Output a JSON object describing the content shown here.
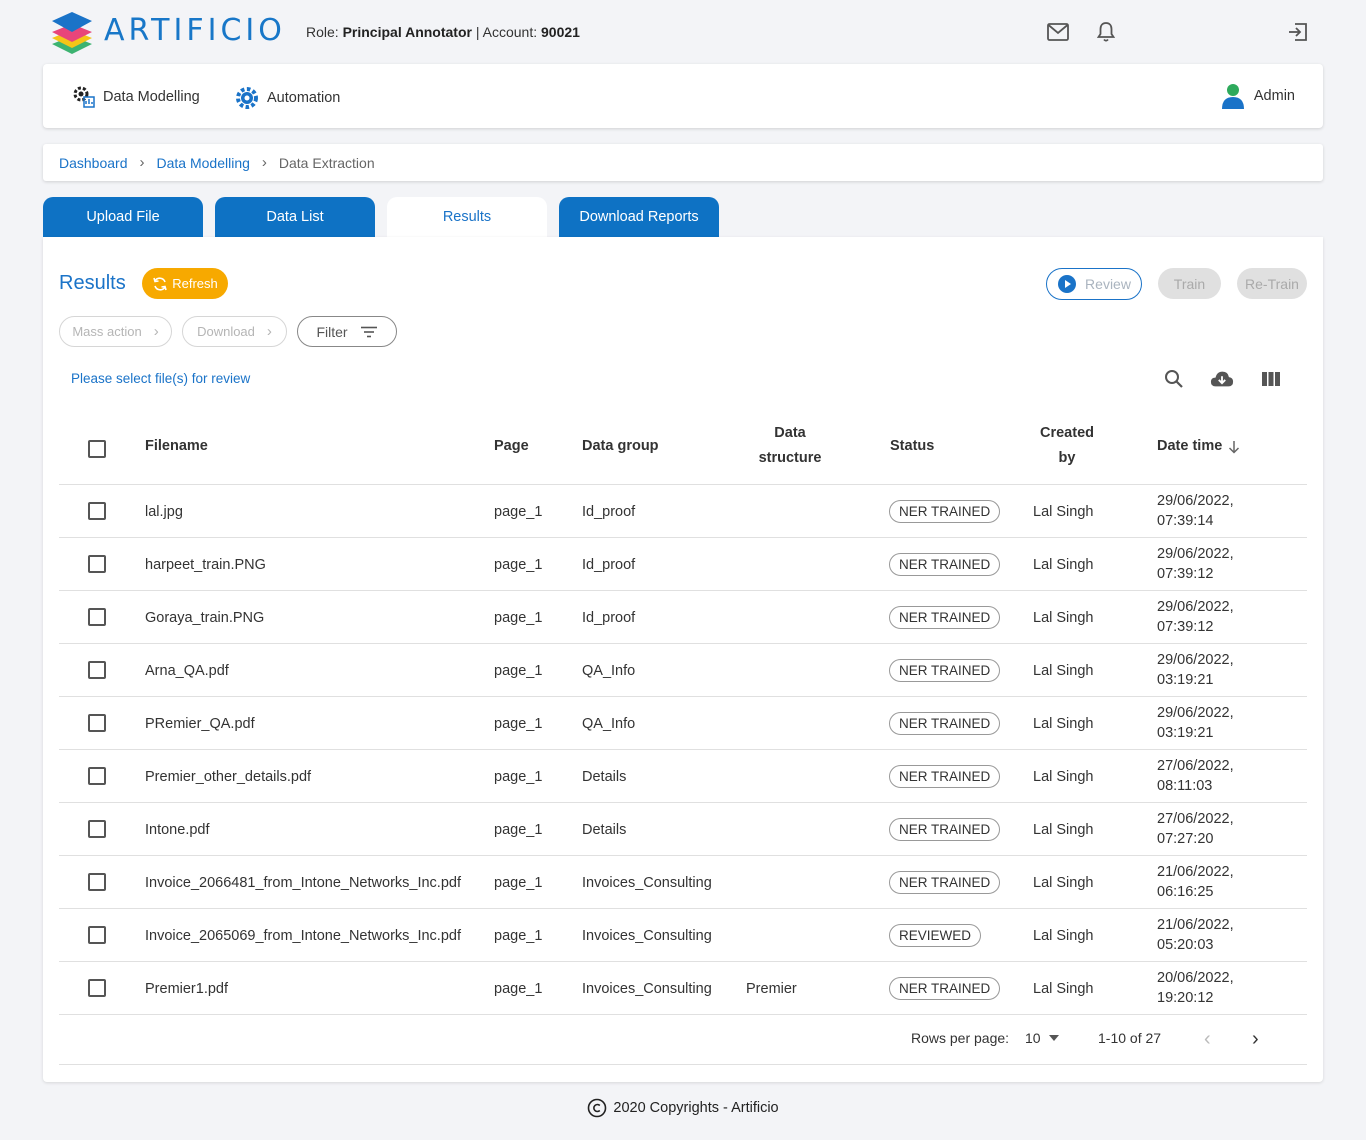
{
  "header": {
    "brand": "ARTIFICIO",
    "role_label": "Role:",
    "role_value": "Principal Annotator",
    "account_sep": "|",
    "account_label": "Account:",
    "account_value": "90021"
  },
  "nav": {
    "items": [
      {
        "label": "Data Modelling",
        "icon": "data-modelling-icon"
      },
      {
        "label": "Automation",
        "icon": "gear-icon"
      }
    ],
    "user": "Admin"
  },
  "breadcrumb": {
    "items": [
      "Dashboard",
      "Data Modelling",
      "Data Extraction"
    ]
  },
  "tabs": [
    {
      "label": "Upload File",
      "active": false
    },
    {
      "label": "Data List",
      "active": false
    },
    {
      "label": "Results",
      "active": true
    },
    {
      "label": "Download Reports",
      "active": false
    }
  ],
  "panel": {
    "title": "Results",
    "refresh_label": "Refresh",
    "review_label": "Review",
    "train_label": "Train",
    "retrain_label": "Re-Train",
    "mass_action_label": "Mass action",
    "download_label": "Download",
    "filter_label": "Filter",
    "select_message": "Please select file(s) for review"
  },
  "table": {
    "headers": {
      "filename": "Filename",
      "page": "Page",
      "data_group": "Data group",
      "data_structure_1": "Data",
      "data_structure_2": "structure",
      "status": "Status",
      "created_by_1": "Created",
      "created_by_2": "by",
      "date_time": "Date time"
    },
    "rows": [
      {
        "filename": "lal.jpg",
        "page": "page_1",
        "data_group": "Id_proof",
        "data_structure": "",
        "status": "NER TRAINED",
        "created_by": "Lal Singh",
        "date": "29/06/2022,",
        "time": "07:39:14"
      },
      {
        "filename": "harpeet_train.PNG",
        "page": "page_1",
        "data_group": "Id_proof",
        "data_structure": "",
        "status": "NER TRAINED",
        "created_by": "Lal Singh",
        "date": "29/06/2022,",
        "time": "07:39:12"
      },
      {
        "filename": "Goraya_train.PNG",
        "page": "page_1",
        "data_group": "Id_proof",
        "data_structure": "",
        "status": "NER TRAINED",
        "created_by": "Lal Singh",
        "date": "29/06/2022,",
        "time": "07:39:12"
      },
      {
        "filename": "Arna_QA.pdf",
        "page": "page_1",
        "data_group": "QA_Info",
        "data_structure": "",
        "status": "NER TRAINED",
        "created_by": "Lal Singh",
        "date": "29/06/2022,",
        "time": "03:19:21"
      },
      {
        "filename": "PRemier_QA.pdf",
        "page": "page_1",
        "data_group": "QA_Info",
        "data_structure": "",
        "status": "NER TRAINED",
        "created_by": "Lal Singh",
        "date": "29/06/2022,",
        "time": "03:19:21"
      },
      {
        "filename": "Premier_other_details.pdf",
        "page": "page_1",
        "data_group": "Details",
        "data_structure": "",
        "status": "NER TRAINED",
        "created_by": "Lal Singh",
        "date": "27/06/2022,",
        "time": "08:11:03"
      },
      {
        "filename": "Intone.pdf",
        "page": "page_1",
        "data_group": "Details",
        "data_structure": "",
        "status": "NER TRAINED",
        "created_by": "Lal Singh",
        "date": "27/06/2022,",
        "time": "07:27:20"
      },
      {
        "filename": "Invoice_2066481_from_Intone_Networks_Inc.pdf",
        "page": "page_1",
        "data_group": "Invoices_Consulting",
        "data_structure": "",
        "status": "NER TRAINED",
        "created_by": "Lal Singh",
        "date": "21/06/2022,",
        "time": "06:16:25"
      },
      {
        "filename": "Invoice_2065069_from_Intone_Networks_Inc.pdf",
        "page": "page_1",
        "data_group": "Invoices_Consulting",
        "data_structure": "",
        "status": "REVIEWED",
        "created_by": "Lal Singh",
        "date": "21/06/2022,",
        "time": "05:20:03"
      },
      {
        "filename": "Premier1.pdf",
        "page": "page_1",
        "data_group": "Invoices_Consulting",
        "data_structure": "Premier",
        "status": "NER TRAINED",
        "created_by": "Lal Singh",
        "date": "20/06/2022,",
        "time": "19:20:12"
      }
    ]
  },
  "pagination": {
    "rows_per_page_label": "Rows per page:",
    "rows_per_page_value": "10",
    "range": "1-10 of 27"
  },
  "footer": {
    "text": "2020 Copyrights - Artificio"
  },
  "colors": {
    "accent": "#1a73c8",
    "tab_blue": "#0e72c4",
    "refresh_orange": "#f7a900"
  }
}
